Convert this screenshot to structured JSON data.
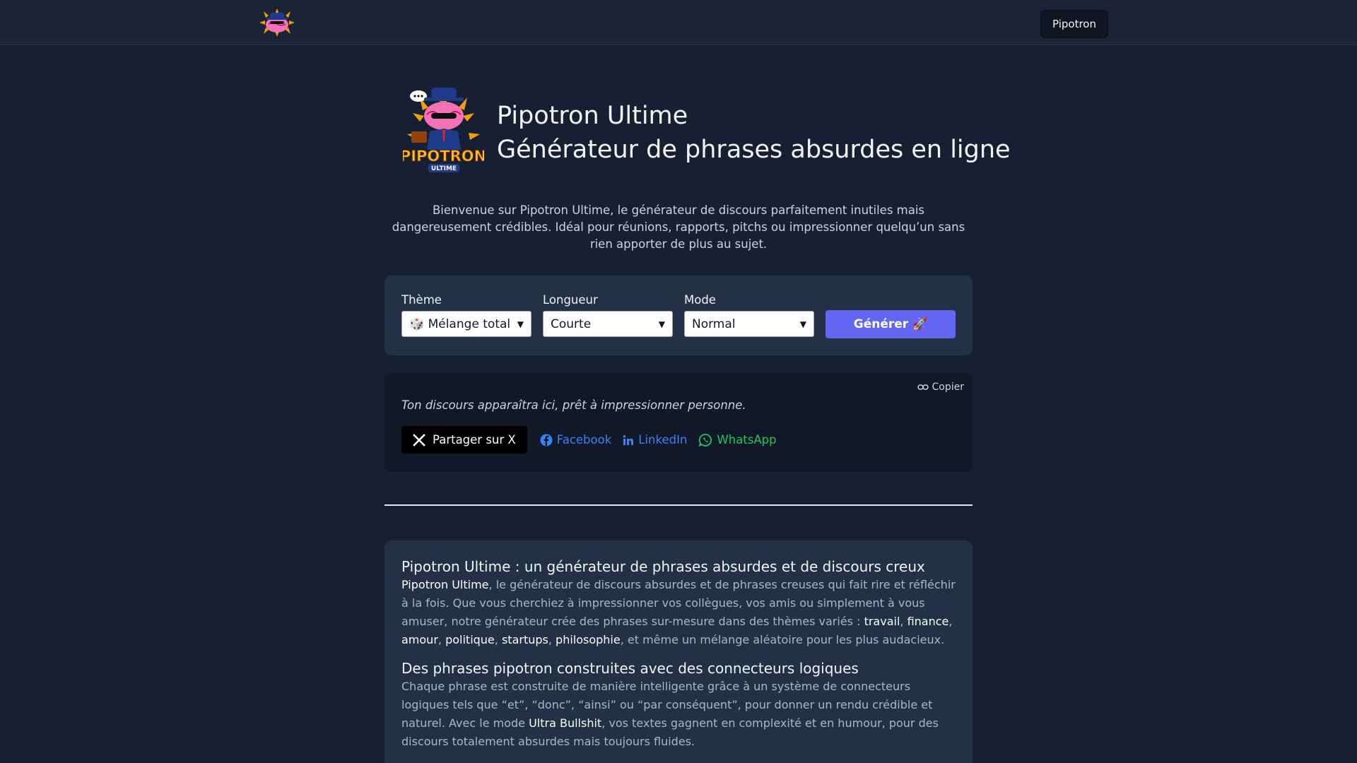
{
  "header": {
    "logo_icon": "pipotron-brain-logo",
    "nav_button": "Pipotron"
  },
  "hero": {
    "logo_icon": "pipotron-ultime-logo",
    "title_line1": "Pipotron Ultime",
    "title_line2": "Générateur de phrases absurdes en ligne"
  },
  "intro": "Bienvenue sur Pipotron Ultime, le générateur de discours parfaitement inutiles mais dangereusement crédibles. Idéal pour réunions, rapports, pitchs ou impressionner quelqu’un sans rien apporter de plus au sujet.",
  "form": {
    "theme_label": "Thème",
    "theme_value": "🎲 Mélange total",
    "length_label": "Longueur",
    "length_value": "Courte",
    "mode_label": "Mode",
    "mode_value": "Normal",
    "generate_label": "Générer 🚀"
  },
  "output": {
    "copy_label": "Copier",
    "placeholder": "Ton discours apparaîtra ici, prêt à impressionner personne.",
    "share_x": "Partager sur X",
    "share_facebook": "Facebook",
    "share_linkedin": "LinkedIn",
    "share_whatsapp": "WhatsApp"
  },
  "info": {
    "h1": "Pipotron Ultime : un générateur de phrases absurdes et de discours creux",
    "p1_strong": "Pipotron Ultime",
    "p1_text": ", le générateur de discours absurdes et de phrases creuses qui fait rire et réfléchir à la fois. Que vous cherchiez à impressionner vos collègues, vos amis ou simplement à vous amuser, notre générateur crée des phrases sur-mesure dans des thèmes variés : ",
    "themes": [
      "travail",
      "finance",
      "amour",
      "politique",
      "startups",
      "philosophie"
    ],
    "p1_end": ", et même un mélange aléatoire pour les plus audacieux.",
    "h2": "Des phrases pipotron construites avec des connecteurs logiques",
    "p2_text": "Chaque phrase est construite de manière intelligente grâce à un système de connecteurs logiques tels que “et”, “donc”, “ainsi” ou “par conséquent”, pour donner un rendu crédible et naturel. Avec le mode ",
    "p2_strong": "Ultra Bullshit",
    "p2_end": ", vos textes gagnent en complexité et en humour, pour des discours totalement absurdes mais toujours fluides."
  },
  "colors": {
    "background": "#172032",
    "card": "#243046",
    "output_card": "#111827",
    "accent": "#6366f1",
    "facebook": "#3b82f6",
    "whatsapp": "#22c55e"
  }
}
